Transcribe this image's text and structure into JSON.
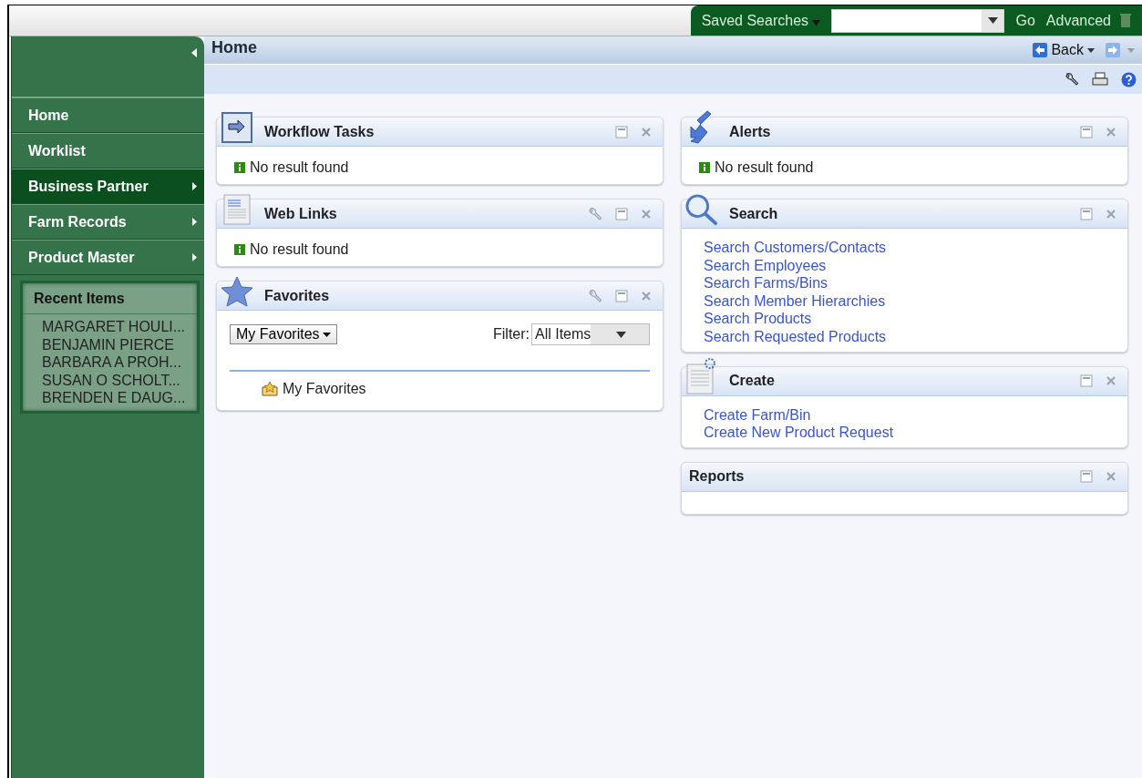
{
  "top_bar": {
    "saved_searches": "Saved Searches",
    "go": "Go",
    "advanced": "Advanced"
  },
  "sidebar": {
    "items": [
      {
        "label": "Home",
        "selected": false,
        "submenu": false
      },
      {
        "label": "Worklist",
        "selected": false,
        "submenu": false
      },
      {
        "label": "Business Partner",
        "selected": true,
        "submenu": true
      },
      {
        "label": "Farm Records",
        "selected": false,
        "submenu": true
      },
      {
        "label": "Product Master",
        "selected": false,
        "submenu": true
      }
    ],
    "recent_items": {
      "title": "Recent Items",
      "items": [
        "MARGARET HOULI...",
        "BENJAMIN PIERCE",
        "BARBARA A PROH...",
        "SUSAN O SCHOLT...",
        "BRENDEN E DAUG..."
      ]
    }
  },
  "page": {
    "title": "Home",
    "back": "Back"
  },
  "left_column": [
    {
      "title": "Workflow Tasks",
      "configurable": false,
      "body": {
        "kind": "message",
        "text": "No result found"
      }
    },
    {
      "title": "Web Links",
      "configurable": true,
      "body": {
        "kind": "message",
        "text": "No result found"
      }
    },
    {
      "title": "Favorites",
      "configurable": true,
      "body": {
        "kind": "favorites",
        "menu": "My Favorites",
        "filter_label": "Filter:",
        "filter_value": "All Items",
        "items": [
          "My Favorites"
        ]
      }
    }
  ],
  "right_column": [
    {
      "title": "Alerts",
      "configurable": false,
      "body": {
        "kind": "message",
        "text": "No result found"
      }
    },
    {
      "title": "Search",
      "configurable": false,
      "body": {
        "kind": "links",
        "links": [
          "Search Customers/Contacts",
          "Search Employees",
          "Search Farms/Bins",
          "Search Member Hierarchies",
          "Search Products",
          "Search Requested Products"
        ]
      }
    },
    {
      "title": "Create",
      "configurable": false,
      "body": {
        "kind": "links",
        "links": [
          "Create Farm/Bin",
          "Create New Product Request"
        ]
      }
    },
    {
      "title": "Reports",
      "configurable": false,
      "body": {
        "kind": "empty"
      }
    }
  ]
}
